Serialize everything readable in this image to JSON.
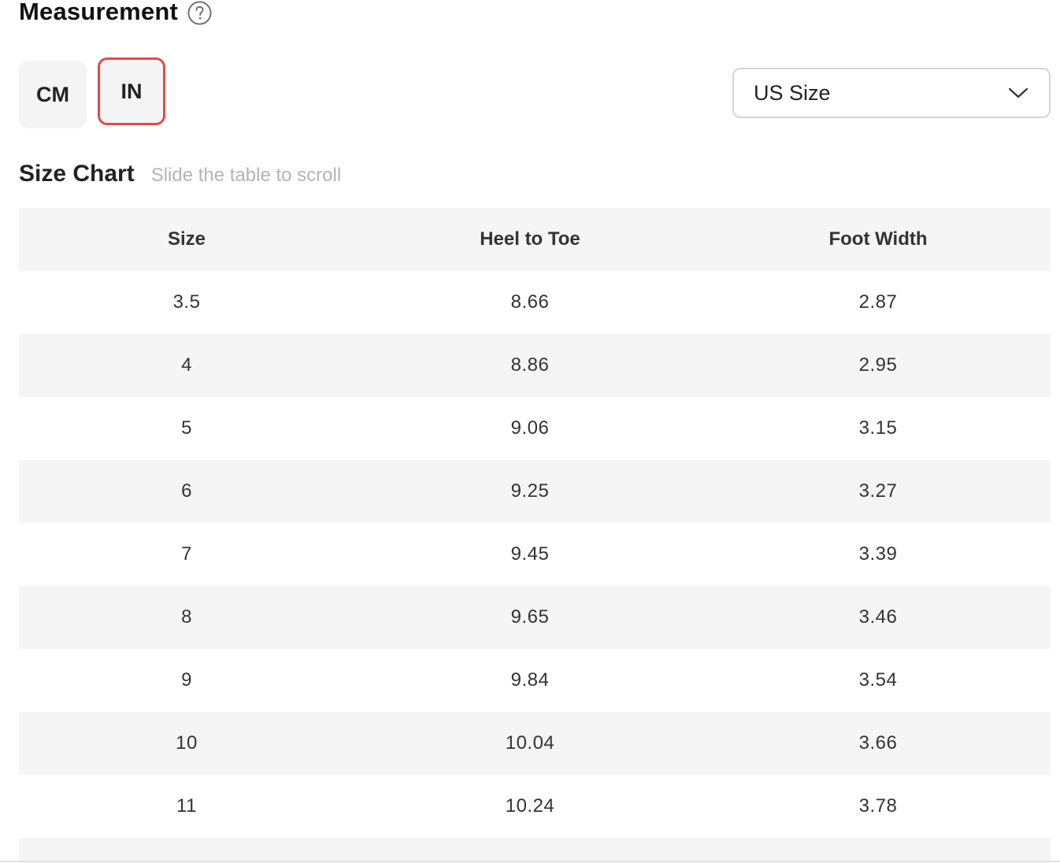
{
  "measurement": {
    "title": "Measurement",
    "help_icon": "question-circle-icon"
  },
  "units": {
    "cm_label": "CM",
    "in_label": "IN",
    "selected": "IN",
    "active_border_color": "#e24a4a"
  },
  "size_system": {
    "selected_value": "US Size",
    "icon": "chevron-down-icon"
  },
  "size_chart": {
    "title": "Size Chart",
    "hint": "Slide the table to scroll",
    "columns": [
      "Size",
      "Heel to Toe",
      "Foot Width"
    ],
    "rows": [
      [
        "3.5",
        "8.66",
        "2.87"
      ],
      [
        "4",
        "8.86",
        "2.95"
      ],
      [
        "5",
        "9.06",
        "3.15"
      ],
      [
        "6",
        "9.25",
        "3.27"
      ],
      [
        "7",
        "9.45",
        "3.39"
      ],
      [
        "8",
        "9.65",
        "3.46"
      ],
      [
        "9",
        "9.84",
        "3.54"
      ],
      [
        "10",
        "10.04",
        "3.66"
      ],
      [
        "11",
        "10.24",
        "3.78"
      ]
    ]
  }
}
